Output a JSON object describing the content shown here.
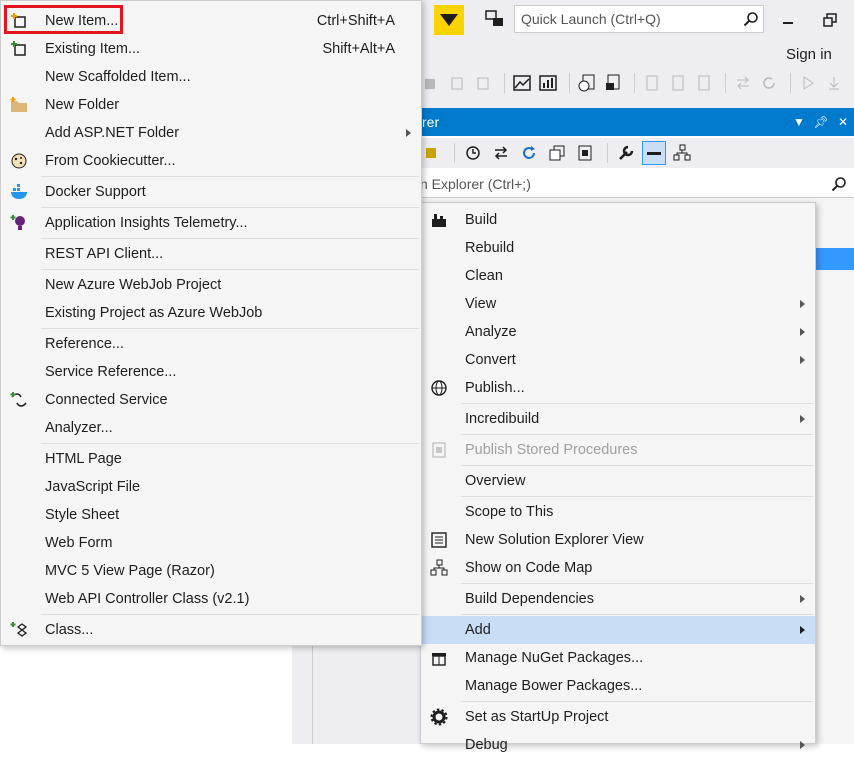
{
  "top": {
    "quick_launch_placeholder": "Quick Launch (Ctrl+Q)",
    "sign_in": "Sign in",
    "accent_color": "#007acc",
    "filter_color": "#f9d400"
  },
  "solution_explorer": {
    "title_fragment": "rer",
    "search_placeholder": "n Explorer (Ctrl+;)"
  },
  "add_submenu": {
    "items": [
      {
        "label": "New Item...",
        "shortcut": "Ctrl+Shift+A",
        "icon": "new-item-icon"
      },
      {
        "label": "Existing Item...",
        "shortcut": "Shift+Alt+A",
        "icon": "existing-item-icon"
      },
      {
        "label": "New Scaffolded Item...",
        "shortcut": "",
        "icon": ""
      },
      {
        "label": "New Folder",
        "shortcut": "",
        "icon": "folder-icon"
      },
      {
        "label": "Add ASP.NET Folder",
        "shortcut": "",
        "icon": "",
        "submenu": true
      },
      {
        "label": "From Cookiecutter...",
        "shortcut": "",
        "icon": "cookiecutter-icon"
      },
      {
        "label": "Docker Support",
        "shortcut": "",
        "icon": "docker-icon"
      },
      {
        "label": "Application Insights Telemetry...",
        "shortcut": "",
        "icon": "insights-icon"
      },
      {
        "label": "REST API Client...",
        "shortcut": "",
        "icon": ""
      },
      {
        "label": "New Azure WebJob Project",
        "shortcut": "",
        "icon": ""
      },
      {
        "label": "Existing Project as Azure WebJob",
        "shortcut": "",
        "icon": ""
      },
      {
        "label": "Reference...",
        "shortcut": "",
        "icon": ""
      },
      {
        "label": "Service Reference...",
        "shortcut": "",
        "icon": ""
      },
      {
        "label": "Connected Service",
        "shortcut": "",
        "icon": "connected-service-icon"
      },
      {
        "label": "Analyzer...",
        "shortcut": "",
        "icon": ""
      },
      {
        "label": "HTML Page",
        "shortcut": "",
        "icon": ""
      },
      {
        "label": "JavaScript File",
        "shortcut": "",
        "icon": ""
      },
      {
        "label": "Style Sheet",
        "shortcut": "",
        "icon": ""
      },
      {
        "label": "Web Form",
        "shortcut": "",
        "icon": ""
      },
      {
        "label": "MVC 5 View Page (Razor)",
        "shortcut": "",
        "icon": ""
      },
      {
        "label": "Web API Controller Class (v2.1)",
        "shortcut": "",
        "icon": ""
      },
      {
        "label": "Class...",
        "shortcut": "",
        "icon": "class-icon"
      }
    ]
  },
  "context_menu": {
    "items": [
      {
        "label": "Build",
        "icon": "build-icon"
      },
      {
        "label": "Rebuild"
      },
      {
        "label": "Clean"
      },
      {
        "label": "View",
        "submenu": true
      },
      {
        "label": "Analyze",
        "submenu": true
      },
      {
        "label": "Convert",
        "submenu": true
      },
      {
        "label": "Publish...",
        "icon": "publish-icon"
      },
      {
        "label": "Incredibuild",
        "submenu": true
      },
      {
        "label": "Publish Stored Procedures",
        "disabled": true,
        "icon": "stored-proc-icon"
      },
      {
        "label": "Overview"
      },
      {
        "label": "Scope to This"
      },
      {
        "label": "New Solution Explorer View",
        "icon": "new-view-icon"
      },
      {
        "label": "Show on Code Map",
        "icon": "code-map-icon"
      },
      {
        "label": "Build Dependencies",
        "submenu": true
      },
      {
        "label": "Add",
        "submenu": true,
        "highlighted": true
      },
      {
        "label": "Manage NuGet Packages...",
        "icon": "nuget-icon"
      },
      {
        "label": "Manage Bower Packages..."
      },
      {
        "label": "Set as StartUp Project",
        "icon": "gear-icon"
      },
      {
        "label": "Debug",
        "submenu": true
      }
    ]
  }
}
